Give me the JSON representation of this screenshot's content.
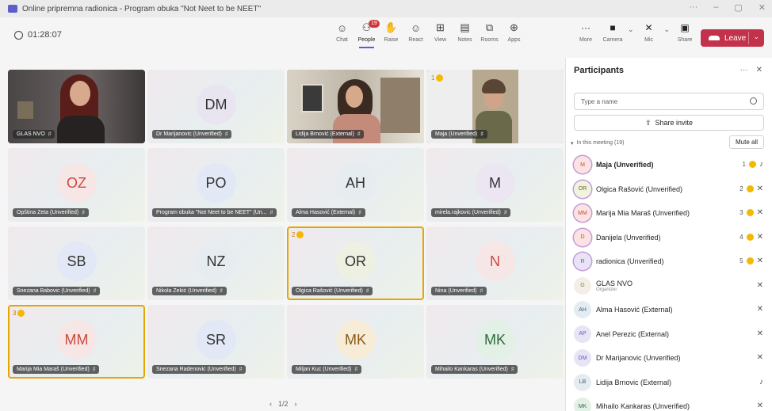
{
  "window": {
    "title": "Online pripremna radionica - Program obuka \"Not Neet to be NEET\"",
    "controls": [
      "···",
      "–",
      "▢",
      "✕"
    ]
  },
  "toolbar": {
    "timer": "01:28:07",
    "tools": [
      {
        "label": "Chat",
        "icon": "chat-icon",
        "glyph": "☺"
      },
      {
        "label": "People",
        "icon": "people-icon",
        "glyph": "⚇",
        "badge": "19",
        "active": true
      },
      {
        "label": "Raise",
        "icon": "raise-hand-icon",
        "glyph": "✋"
      },
      {
        "label": "React",
        "icon": "react-icon",
        "glyph": "☺"
      },
      {
        "label": "View",
        "icon": "view-icon",
        "glyph": "⊞"
      },
      {
        "label": "Notes",
        "icon": "notes-icon",
        "glyph": "▤"
      },
      {
        "label": "Rooms",
        "icon": "rooms-icon",
        "glyph": "⧉"
      },
      {
        "label": "Apps",
        "icon": "apps-icon",
        "glyph": "⊕"
      }
    ],
    "devices": [
      {
        "label": "More",
        "icon": "more-icon",
        "glyph": "···"
      },
      {
        "label": "Camera",
        "icon": "camera-icon",
        "glyph": "■"
      },
      {
        "label": "Mic",
        "icon": "mic-off-icon",
        "glyph": "✕"
      },
      {
        "label": "Share",
        "icon": "share-icon",
        "glyph": "▣"
      }
    ],
    "leave": "Leave"
  },
  "tiles": [
    {
      "name": "GLAS NVO",
      "video": true,
      "scene": "woman-red-hair"
    },
    {
      "name": "Dr Marijanovic (Unverified)",
      "initials": "DM",
      "avatar_bg": "#e8e4f0"
    },
    {
      "name": "Lidija Brnović (External)",
      "video": true,
      "scene": "woman-room"
    },
    {
      "name": "Maja (Unverified)",
      "video": true,
      "scene": "woman-wall",
      "hand": "1",
      "highlight": "blue"
    },
    {
      "name": "Opština Zeta (Unverified)",
      "initials": "OZ",
      "avatar_bg": "#f6e6e6",
      "initials_color": "#c94a3c"
    },
    {
      "name": "Program obuka \"Not Neet to be NEET\" (Un...",
      "initials": "PO",
      "avatar_bg": "#e2e8f5"
    },
    {
      "name": "Alma Hasović (External)",
      "initials": "AH",
      "avatar_bg": "#e6ecf0"
    },
    {
      "name": "mirela.rajkovic (Unverified)",
      "initials": "M",
      "avatar_bg": "#ece6f2"
    },
    {
      "name": "Snezana Babovic (Unverified)",
      "initials": "SB",
      "avatar_bg": "#e2e8f5"
    },
    {
      "name": "Nikola Zekić (Unverified)",
      "initials": "NZ",
      "avatar_bg": "#e6ecf0"
    },
    {
      "name": "Olgica Rašović (Unverified)",
      "initials": "OR",
      "avatar_bg": "#eef0e2",
      "hand": "2",
      "highlight": "gold"
    },
    {
      "name": "Nina (Unverified)",
      "initials": "N",
      "avatar_bg": "#f6e6e6",
      "initials_color": "#c94a3c"
    },
    {
      "name": "Marija Mia Maraš (Unverified)",
      "initials": "MM",
      "avatar_bg": "#f6e6e6",
      "initials_color": "#c94a3c",
      "hand": "3",
      "highlight": "gold"
    },
    {
      "name": "Snezana Radenovic (Unverified)",
      "initials": "SR",
      "avatar_bg": "#e2e8f5"
    },
    {
      "name": "Miljan Kuc (Unverified)",
      "initials": "MK",
      "avatar_bg": "#f6ecd8",
      "initials_color": "#8a5a14"
    },
    {
      "name": "Mihailo Kankaras (Unverified)",
      "initials": "MK",
      "avatar_bg": "#e2f0e6",
      "initials_color": "#2f6b3f"
    }
  ],
  "pager": {
    "prev": "‹",
    "page": "1/2",
    "next": "›"
  },
  "panel": {
    "title": "Participants",
    "search_placeholder": "Type a name",
    "share_invite": "Share invite",
    "section_label": "In this meeting (19)",
    "mute_all": "Mute all",
    "participants": [
      {
        "initials": "M",
        "name": "Maja (Unverified)",
        "bold": true,
        "hand": "1",
        "mic": "on",
        "avatar_bg": "#fbe3e3",
        "initials_color": "#c94a3c"
      },
      {
        "initials": "OR",
        "name": "Olgica Rašović (Unverified)",
        "hand": "2",
        "mic": "off",
        "avatar_bg": "#f1f3e0",
        "initials_color": "#6b6b1e"
      },
      {
        "initials": "MM",
        "name": "Marija Mia Maraš (Unverified)",
        "hand": "3",
        "mic": "off",
        "avatar_bg": "#fbe3e3",
        "initials_color": "#c94a3c"
      },
      {
        "initials": "D",
        "name": "Danijela (Unverified)",
        "hand": "4",
        "mic": "off",
        "avatar_bg": "#fbe3e3",
        "initials_color": "#c94a3c"
      },
      {
        "initials": "R",
        "name": "radionica (Unverified)",
        "hand": "5",
        "mic": "off",
        "avatar_bg": "#e8e4f5",
        "initials_color": "#5b5fc7"
      },
      {
        "initials": "G",
        "name": "GLAS NVO",
        "subtitle": "Organizer",
        "mic": "off",
        "avatar_bg": "#f3efe6",
        "initials_color": "#8a7a50"
      },
      {
        "initials": "AH",
        "name": "Alma Hasović (External)",
        "mic": "off",
        "avatar_bg": "#e4ecf2",
        "initials_color": "#3c5a78"
      },
      {
        "initials": "AP",
        "name": "Anel Perezic (External)",
        "mic": "off",
        "avatar_bg": "#e6e4f5",
        "initials_color": "#5b5fc7"
      },
      {
        "initials": "DM",
        "name": "Dr Marijanovic (Unverified)",
        "mic": "off",
        "avatar_bg": "#e6e4f5",
        "initials_color": "#5b5fc7"
      },
      {
        "initials": "LB",
        "name": "Lidija Brnovic (External)",
        "mic": "on",
        "avatar_bg": "#e4ecf2",
        "initials_color": "#3c5a78"
      },
      {
        "initials": "MK",
        "name": "Mihailo Kankaras (Unverified)",
        "mic": "off",
        "avatar_bg": "#e2f0e6",
        "initials_color": "#2f6b3f"
      }
    ]
  }
}
